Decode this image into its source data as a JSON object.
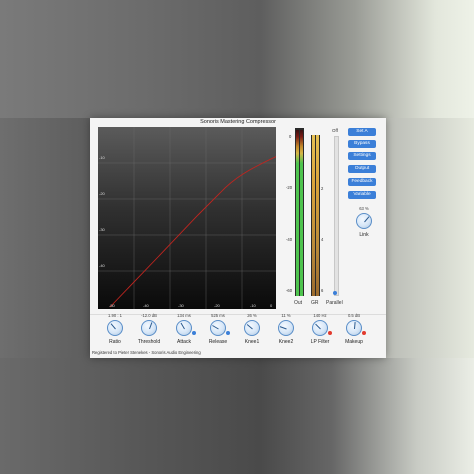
{
  "window": {
    "title": "Sonoris Mastering Compressor"
  },
  "graph": {
    "y_labels": [
      "-10",
      "-20",
      "-30",
      "-40"
    ],
    "x_labels": [
      "-50",
      "-40",
      "-30",
      "-20",
      "-10",
      "0"
    ]
  },
  "meters": {
    "scale": [
      "0",
      "-20",
      "-40",
      "-60"
    ],
    "gr_scale": [
      "2",
      "4",
      "6"
    ],
    "labels": {
      "out": "Out",
      "gr": "GR",
      "parallel": "Parallel"
    }
  },
  "off_label": "Off",
  "buttons": [
    {
      "label": "Set A"
    },
    {
      "label": "Bypass"
    },
    {
      "label": "Settings"
    },
    {
      "label": "Output"
    },
    {
      "label": "Feedback"
    },
    {
      "label": "Variable"
    }
  ],
  "link": {
    "value": "63 %",
    "name": "Link"
  },
  "knobs": [
    {
      "name": "Ratio",
      "value": "1.90 : 1"
    },
    {
      "name": "Threshold",
      "value": "-12.0 dB"
    },
    {
      "name": "Attack",
      "value": "134 ms"
    },
    {
      "name": "Release",
      "value": "525 ms"
    },
    {
      "name": "Knee1",
      "value": "26 %"
    },
    {
      "name": "Knee2",
      "value": "11 %"
    },
    {
      "name": "LP Filter",
      "value": "140 Hz"
    },
    {
      "name": "Makeup",
      "value": "0.5 dB"
    }
  ],
  "colors": {
    "accent": "#3b7fd8",
    "curve": "#c0251f",
    "led_red": "#e23a2d",
    "led_blue": "#3b7fd8"
  },
  "footer": "Registered to Pieter Stenekes - Sonoris Audio Engineering"
}
